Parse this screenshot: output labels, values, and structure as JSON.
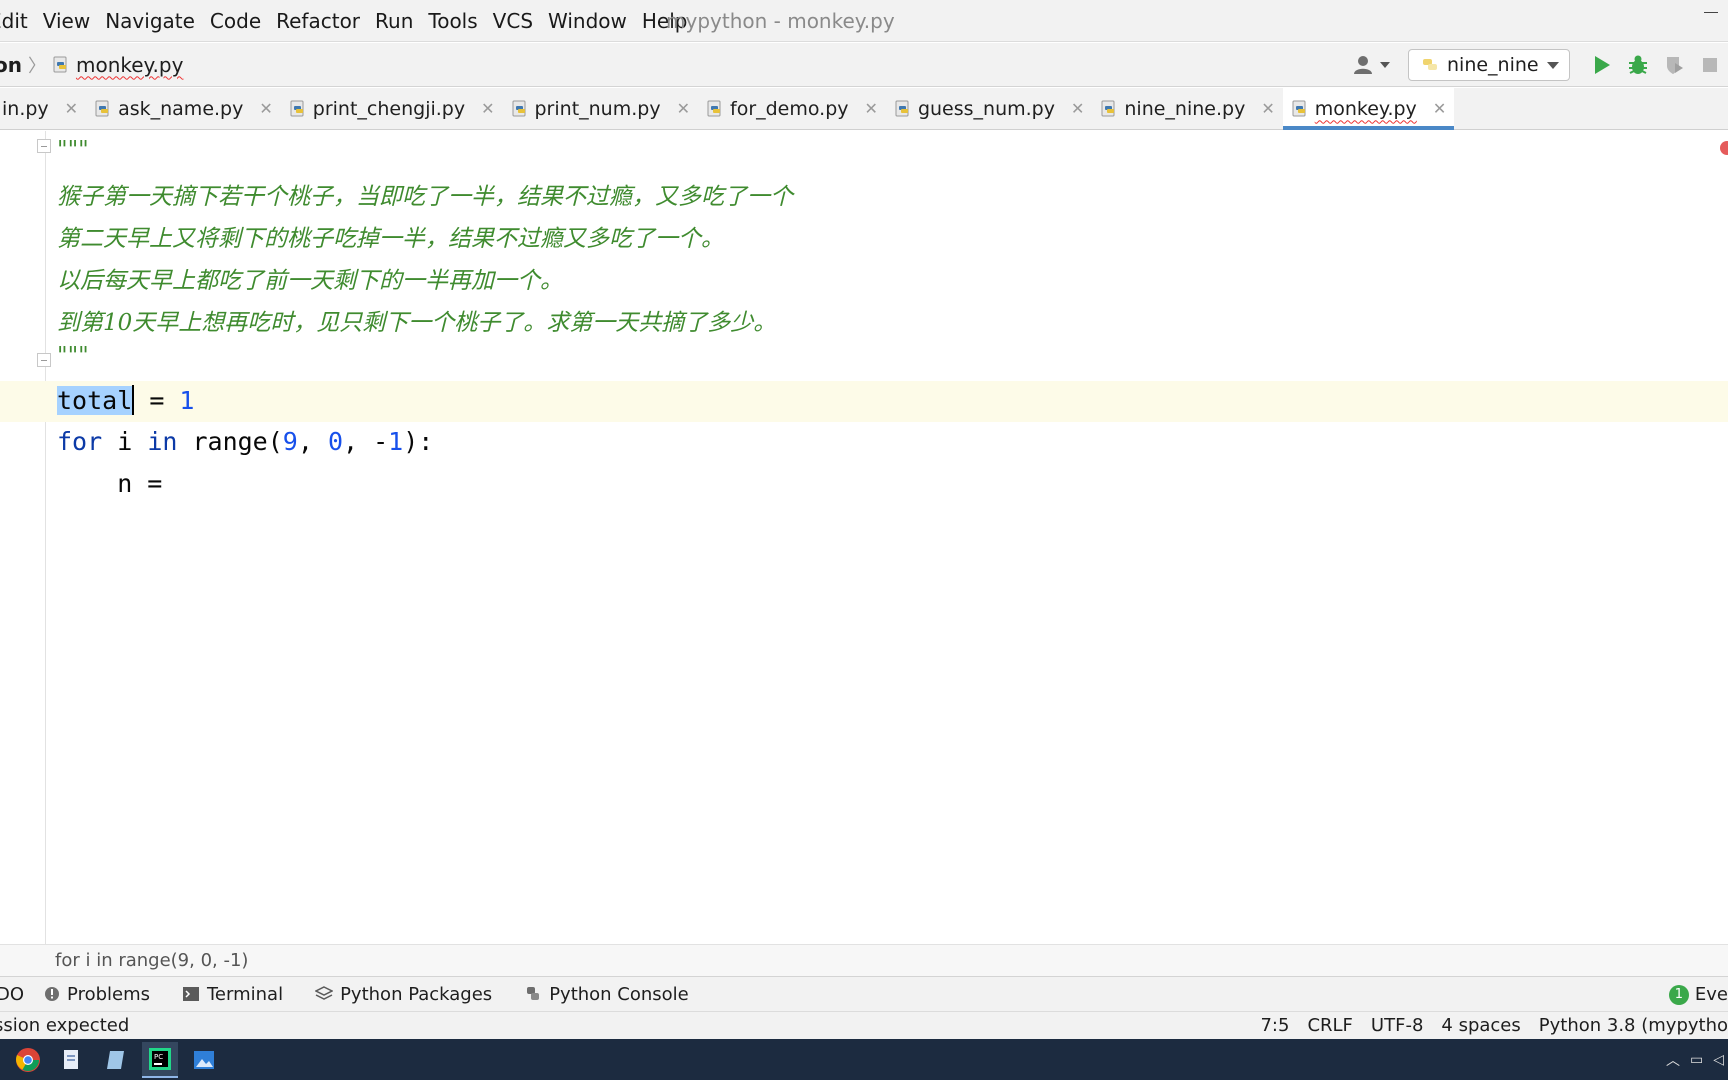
{
  "menubar": {
    "items": [
      "Edit",
      "View",
      "Navigate",
      "Code",
      "Refactor",
      "Run",
      "Tools",
      "VCS",
      "Window",
      "Help"
    ],
    "window_title": "mypython - monkey.py"
  },
  "navbar": {
    "root_crumb": "on",
    "file_crumb": "monkey.py",
    "run_config": "nine_nine"
  },
  "tabs": [
    {
      "label": "in.py"
    },
    {
      "label": "ask_name.py"
    },
    {
      "label": "print_chengji.py"
    },
    {
      "label": "print_num.py"
    },
    {
      "label": "for_demo.py"
    },
    {
      "label": "guess_num.py"
    },
    {
      "label": "nine_nine.py"
    },
    {
      "label": "monkey.py"
    }
  ],
  "editor": {
    "doc_open": "\"\"\"",
    "doc_lines": [
      "猴子第一天摘下若干个桃子，当即吃了一半，结果不过瘾，又多吃了一个",
      "第二天早上又将剩下的桃子吃掉一半，结果不过瘾又多吃了一个。",
      "以后每天早上都吃了前一天剩下的一半再加一个。",
      "到第10天早上想再吃时，见只剩下一个桃子了。求第一天共摘了多少。"
    ],
    "doc_close": "\"\"\"",
    "line_total_var": "total",
    "line_total_rest": " = ",
    "line_total_val": "1",
    "line_for_kw": "for",
    "line_for_var": " i ",
    "line_for_in": "in",
    "line_for_call": " range(",
    "line_for_a": "9",
    "line_for_sep1": ", ",
    "line_for_b": "0",
    "line_for_sep2": ", -",
    "line_for_c": "1",
    "line_for_end": "):",
    "line_n": "    n = "
  },
  "context_bar": "for i in range(9, 0, -1)",
  "toolwindows": {
    "todo": "DO",
    "problems": "Problems",
    "terminal": "Terminal",
    "packages": "Python Packages",
    "console": "Python Console",
    "events": "Eve",
    "events_count": "1"
  },
  "statusbar": {
    "message": "ssion expected",
    "position": "7:5",
    "line_sep": "CRLF",
    "encoding": "UTF-8",
    "indent": "4 spaces",
    "interpreter": "Python 3.8 (mypytho"
  },
  "colors": {
    "accent": "#4a88c7",
    "docstring": "#3f8b2f",
    "keyword": "#0c3aa7",
    "number": "#1750eb",
    "selection": "#a6d2ff",
    "taskbar": "#1c2b40"
  }
}
